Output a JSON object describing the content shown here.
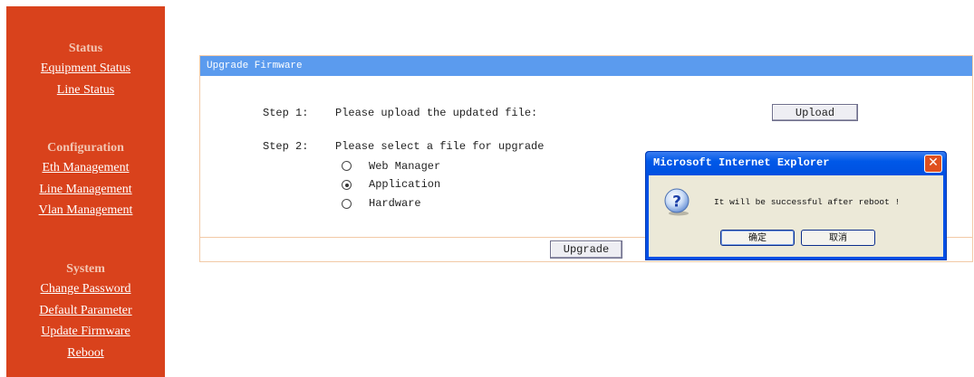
{
  "sidebar": {
    "status": {
      "heading": "Status",
      "links": [
        "Equipment Status",
        "Line Status"
      ]
    },
    "configuration": {
      "heading": "Configuration",
      "links": [
        "Eth Management",
        "Line Management",
        "Vlan Management"
      ]
    },
    "system": {
      "heading": "System",
      "links": [
        "Change Password",
        "Default Parameter",
        "Update Firmware",
        "Reboot"
      ]
    }
  },
  "panel": {
    "title": "Upgrade Firmware",
    "step1": {
      "label": "Step 1:",
      "text": "Please upload the updated file:",
      "button": "Upload"
    },
    "step2": {
      "label": "Step 2:",
      "text": "Please select a file for upgrade",
      "options": [
        "Web Manager",
        "Application",
        "Hardware"
      ],
      "selected": "Application"
    },
    "upgrade_button": "Upgrade"
  },
  "dialog": {
    "title": "Microsoft Internet Explorer",
    "close_glyph": "✕",
    "message": "It will be successful after reboot !",
    "ok_label": "确定",
    "cancel_label": "取消",
    "icon": "question-icon"
  },
  "colors": {
    "sidebar_bg": "#d9421c",
    "panel_title_bg": "#5b9bee",
    "dialog_frame": "#0050e6",
    "dialog_body": "#ece9d8"
  }
}
